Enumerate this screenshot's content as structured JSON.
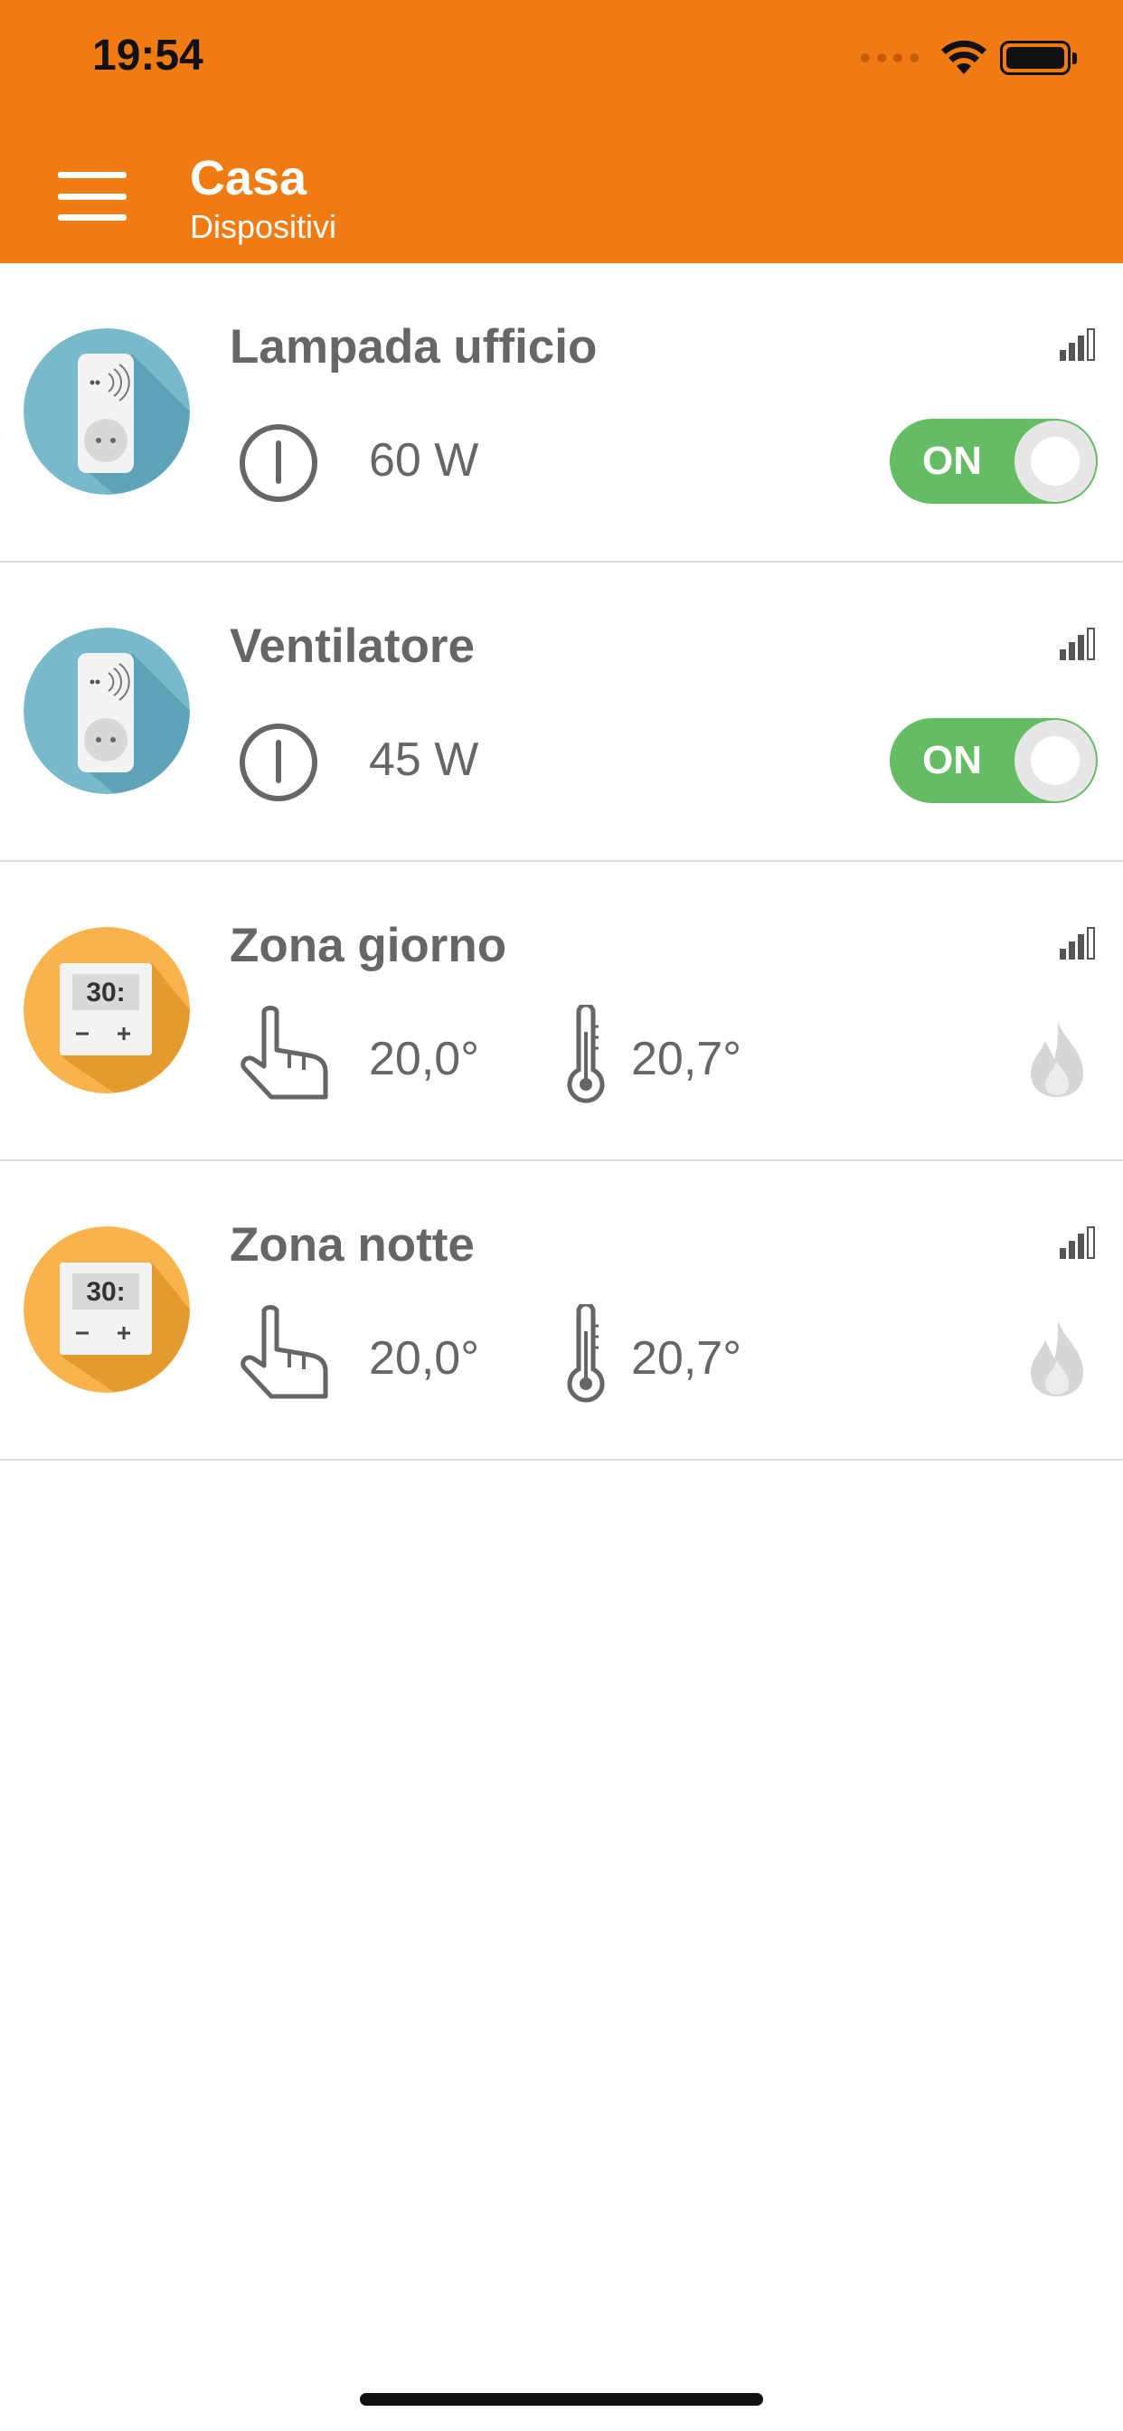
{
  "status_bar": {
    "time": "19:54"
  },
  "header": {
    "title": "Casa",
    "subtitle": "Dispositivi",
    "color": "#F07B12"
  },
  "devices": [
    {
      "name": "Lampada ufficio",
      "type": "plug",
      "power": "60 W",
      "toggle_label": "ON",
      "state_on": true
    },
    {
      "name": "Ventilatore",
      "type": "plug",
      "power": "45 W",
      "toggle_label": "ON",
      "state_on": true
    },
    {
      "name": "Zona giorno",
      "type": "thermostat",
      "setpoint": "20,0°",
      "temperature": "20,7°"
    },
    {
      "name": "Zona notte",
      "type": "thermostat",
      "setpoint": "20,0°",
      "temperature": "20,7°"
    }
  ],
  "icons": {
    "menu": "hamburger-menu-icon",
    "plug": "smart-plug-icon",
    "thermostat": "thermostat-icon",
    "power": "power-icon",
    "hand": "hand-pointer-icon",
    "thermometer": "thermometer-icon",
    "flame": "flame-icon",
    "signal": "signal-strength-icon"
  },
  "colors": {
    "toggle_on": "#64BD63",
    "plug_bg": "#78B9CC",
    "thermostat_bg": "#F8B34C",
    "text": "#666666"
  }
}
